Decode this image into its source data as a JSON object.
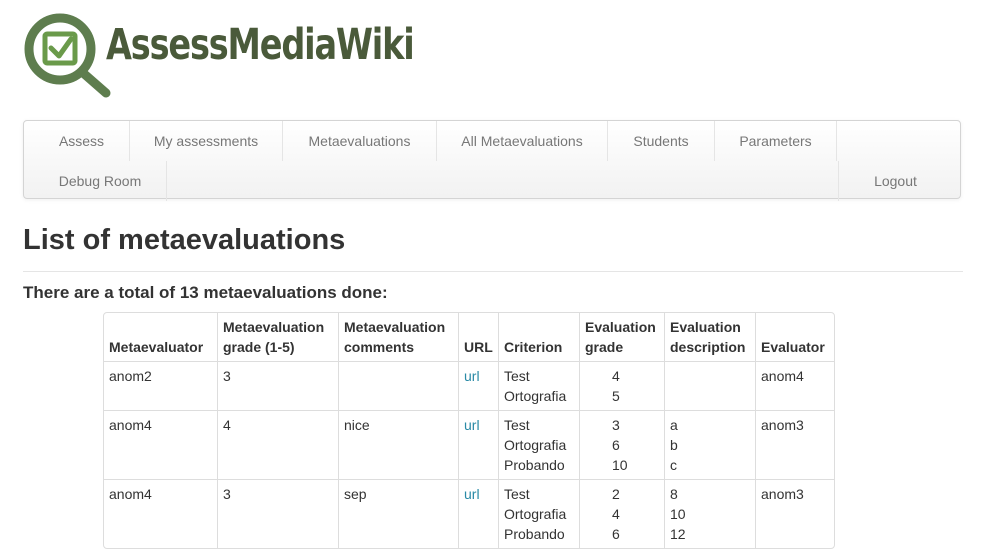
{
  "brand": {
    "name": "AssessMediaWiki",
    "icon": "magnifier-checkbox-icon",
    "colors": {
      "ring": "#5e7d4e",
      "check": "#6a9a4a",
      "text": "#4a5a3a"
    }
  },
  "nav": {
    "items": [
      "Assess",
      "My assessments",
      "Metaevaluations",
      "All Metaevaluations",
      "Students",
      "Parameters",
      "Debug Room"
    ],
    "logout": "Logout"
  },
  "page": {
    "title": "List of metaevaluations",
    "summary": "There are a total of 13 metaevaluations done:"
  },
  "table": {
    "headers": {
      "metaevaluator": "Metaevaluator",
      "grade": "Metaevaluation grade (1-5)",
      "comments": "Metaevaluation comments",
      "url": "URL",
      "criterion": "Criterion",
      "eval_grade": "Evaluation grade",
      "eval_desc": "Evaluation description",
      "evaluator": "Evaluator"
    },
    "rows": [
      {
        "metaevaluator": "anom2",
        "grade": "3",
        "comments": "",
        "url": "url",
        "criteria": [
          "Test",
          "Ortografia"
        ],
        "eval_grades": [
          "4",
          "5"
        ],
        "eval_desc": [],
        "evaluator": "anom4"
      },
      {
        "metaevaluator": "anom4",
        "grade": "4",
        "comments": "nice",
        "url": "url",
        "criteria": [
          "Test",
          "Ortografia",
          "Probando"
        ],
        "eval_grades": [
          "3",
          "6",
          "10"
        ],
        "eval_desc": [
          "a",
          "b",
          "c"
        ],
        "evaluator": "anom3"
      },
      {
        "metaevaluator": "anom4",
        "grade": "3",
        "comments": "sep",
        "url": "url",
        "criteria": [
          "Test",
          "Ortografia",
          "Probando"
        ],
        "eval_grades": [
          "2",
          "4",
          "6"
        ],
        "eval_desc": [
          "8",
          "10",
          "12"
        ],
        "evaluator": "anom3"
      }
    ]
  }
}
